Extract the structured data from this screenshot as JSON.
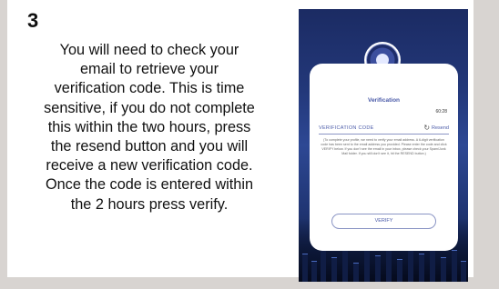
{
  "step": "3",
  "instructions": [
    "You will need to check your",
    "email to retrieve your",
    "verification code. This is time",
    "sensitive, if you do not complete",
    "this within the two hours, press",
    "the resend button and you will",
    "receive a new verification code.",
    "Once the code is entered within",
    "the 2 hours press verify."
  ],
  "phone": {
    "logo_icon": "seal-icon",
    "title": "Verification",
    "timer": "60:28",
    "code_label": "VERIFICATION CODE",
    "resend_icon": "refresh-icon",
    "resend_label": "Resend",
    "help_text": "(To complete your profile, we need to verify your email address. A 6-digit verification code has been sent to the email address you provided. Please enter the code and click VERIFY below. If you don't see the email in your inbox, please check your Spam/Junk Mail folder. If you still don't see it, hit the RESEND button.)",
    "verify_label": "VERIFY"
  }
}
